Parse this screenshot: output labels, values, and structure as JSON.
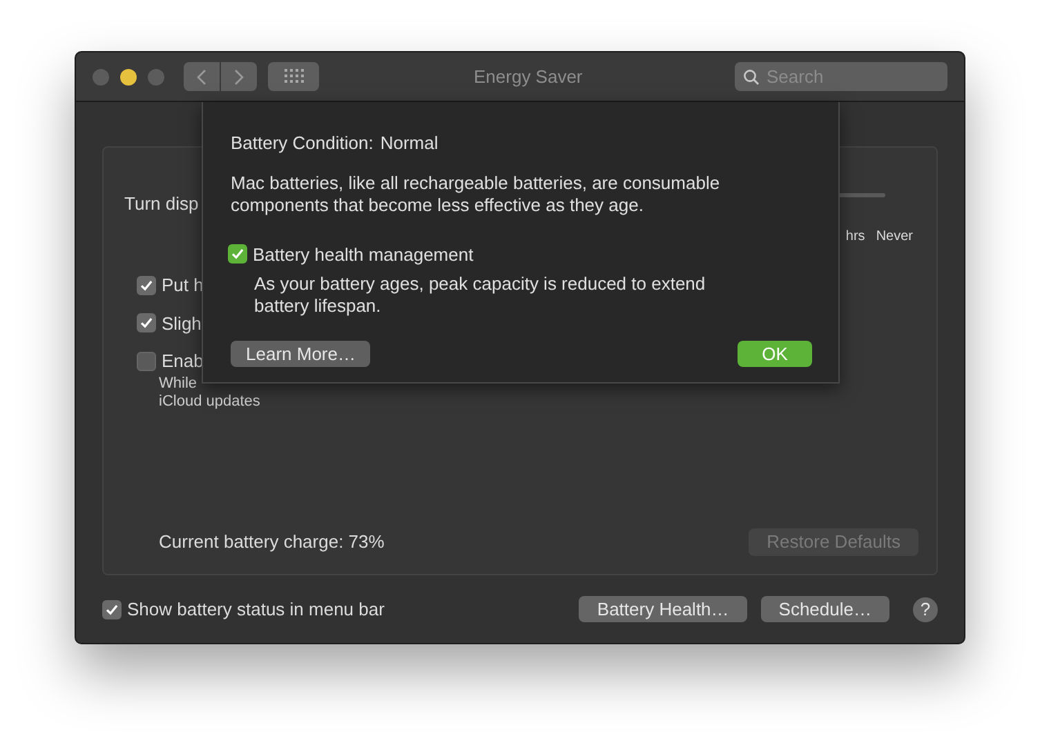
{
  "window": {
    "title": "Energy Saver",
    "search": {
      "placeholder": "Search"
    }
  },
  "panel": {
    "display_label": "Turn disp",
    "slider_labels": [
      "hrs",
      "Never"
    ],
    "options": [
      {
        "label": "Put h",
        "checked": true
      },
      {
        "label": "Sligh",
        "checked": true
      },
      {
        "label": "Enab",
        "checked": false,
        "note_lines": [
          "While",
          "iCloud updates"
        ]
      }
    ],
    "charge": "Current battery charge: 73%",
    "restore_button": {
      "label": "Restore Defaults",
      "disabled": true
    }
  },
  "footer": {
    "show_status": {
      "label": "Show battery status in menu bar",
      "checked": true
    },
    "buttons": [
      "Battery Health…",
      "Schedule…"
    ],
    "help": "?"
  },
  "sheet": {
    "condition_label": "Battery Condition:",
    "condition_value": "Normal",
    "description": "Mac batteries, like all rechargeable batteries, are consumable components that become less effective as they age.",
    "management": {
      "label": "Battery health management",
      "checked": true
    },
    "management_note": "As your battery ages, peak capacity is reduced to extend battery lifespan.",
    "learn_more": "Learn More…",
    "ok": "OK"
  }
}
